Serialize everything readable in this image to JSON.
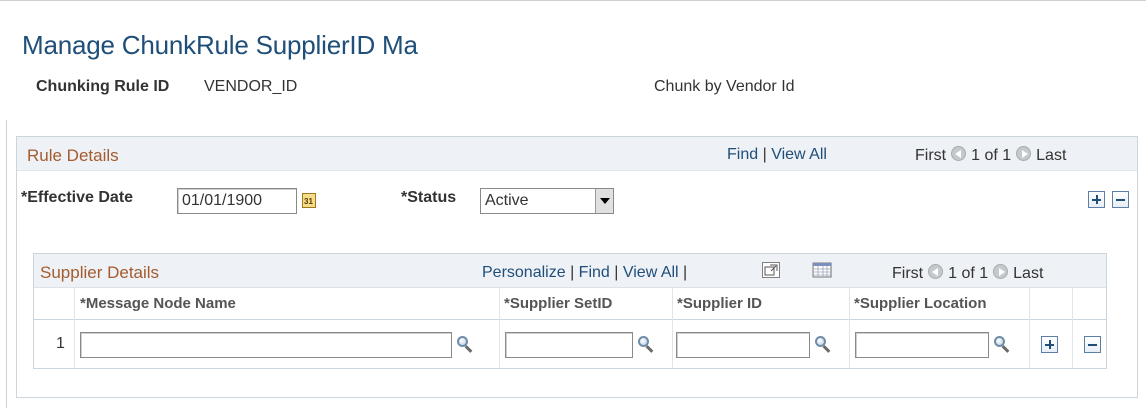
{
  "page": {
    "title": "Manage ChunkRule SupplierID Ma",
    "chunking_rule_label": "Chunking Rule ID",
    "chunking_rule_value": "VENDOR_ID",
    "chunking_rule_desc": "Chunk by Vendor Id"
  },
  "rule_details": {
    "title": "Rule Details",
    "nav": {
      "find": "Find",
      "sep": "|",
      "view_all": "View All",
      "first": "First",
      "range": "1 of 1",
      "last": "Last"
    },
    "effective_date_label": "*Effective Date",
    "effective_date_value": "01/01/1900",
    "calendar_glyph": "31",
    "status_label": "*Status",
    "status_value": "Active"
  },
  "supplier_details": {
    "title": "Supplier Details",
    "nav": {
      "personalize": "Personalize",
      "sep": "|",
      "find": "Find",
      "view_all": "View All",
      "first": "First",
      "range": "1 of 1",
      "last": "Last"
    },
    "columns": [
      "*Message Node Name",
      "*Supplier SetID",
      "*Supplier ID",
      "*Supplier Location"
    ],
    "rows": [
      {
        "num": "1",
        "message_node_name": "",
        "supplier_setid": "",
        "supplier_id": "",
        "supplier_location": ""
      }
    ]
  },
  "icons": {
    "add": "plus-icon",
    "delete": "minus-icon",
    "lookup": "magnifier-icon",
    "calendar": "calendar-icon",
    "zoom": "new-window-icon",
    "download": "spreadsheet-icon",
    "prev": "arrow-left-icon",
    "next": "arrow-right-icon"
  },
  "colors": {
    "title": "#1f4e79",
    "section_title": "#a45c2e",
    "link": "#1f4e79",
    "header_bg": "#eef1f5"
  }
}
